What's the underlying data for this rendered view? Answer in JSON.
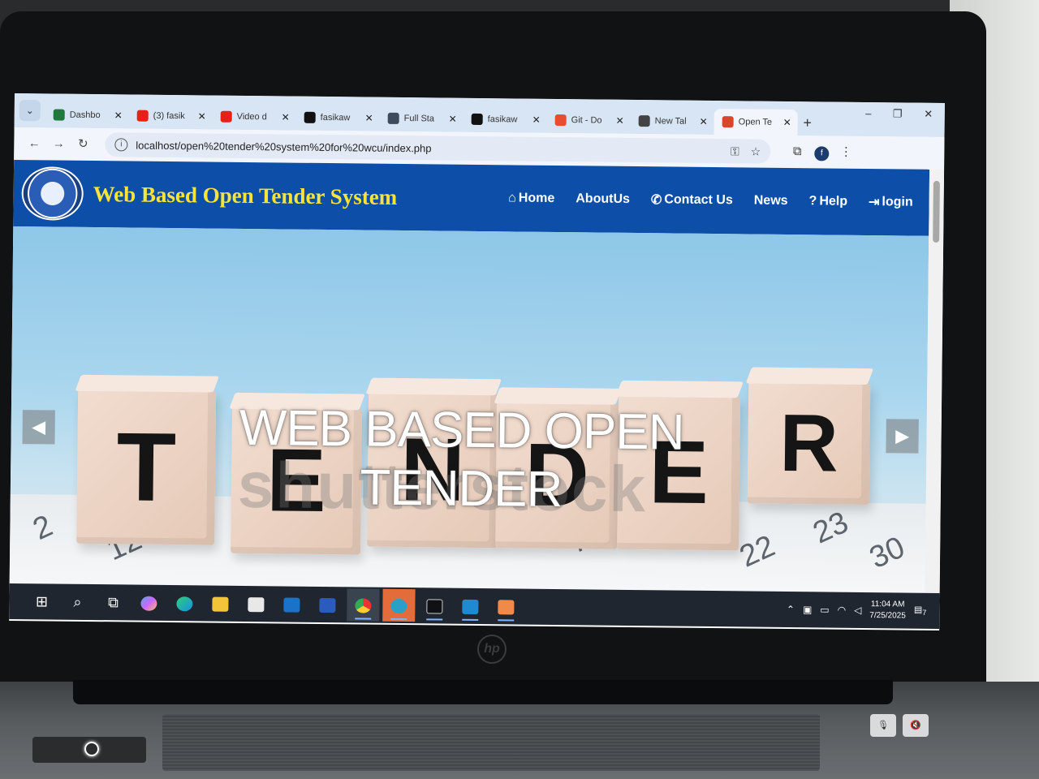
{
  "browser": {
    "tabs": [
      {
        "title": "Dashbo",
        "icon": "globe-icon",
        "color": "#1e7a3c"
      },
      {
        "title": "(3) fasik",
        "icon": "youtube-icon",
        "color": "#e62117"
      },
      {
        "title": "Video d",
        "icon": "youtube-icon",
        "color": "#e62117"
      },
      {
        "title": "fasikaw",
        "icon": "github-icon",
        "color": "#111111"
      },
      {
        "title": "Full Sta",
        "icon": "globe-icon",
        "color": "#3d4b5e"
      },
      {
        "title": "fasikaw",
        "icon": "github-icon",
        "color": "#111111"
      },
      {
        "title": "Git - Do",
        "icon": "git-icon",
        "color": "#e84d31"
      },
      {
        "title": "New Tal",
        "icon": "chrome-icon",
        "color": "#444444"
      },
      {
        "title": "Open Te",
        "icon": "xampp-icon",
        "color": "#d9472b",
        "active": true
      }
    ],
    "url": "localhost/open%20tender%20system%20for%20wcu/index.php",
    "profile_initial": "f"
  },
  "site": {
    "title": "Web Based Open Tender System",
    "nav": [
      {
        "label": "Home",
        "icon": "home-icon",
        "glyph": "⌂"
      },
      {
        "label": "AboutUs",
        "icon": "",
        "glyph": ""
      },
      {
        "label": "Contact Us",
        "icon": "phone-icon",
        "glyph": "✆"
      },
      {
        "label": "News",
        "icon": "",
        "glyph": ""
      },
      {
        "label": "Help",
        "icon": "help-icon",
        "glyph": "?"
      },
      {
        "label": "login",
        "icon": "login-icon",
        "glyph": "⇥"
      }
    ],
    "hero": {
      "heading": "WEB BASED OPEN TENDER",
      "watermark": "shutterstock",
      "cube_letters": [
        "T",
        "E",
        "N",
        "D",
        "E",
        "R"
      ]
    }
  },
  "taskbar": {
    "time": "11:04 AM",
    "date": "7/25/2025",
    "notification_count": "7"
  },
  "colors": {
    "nav_bg": "#0d4ea8",
    "title_yellow": "#f6e43a",
    "tabstrip": "#d7e5f4"
  }
}
